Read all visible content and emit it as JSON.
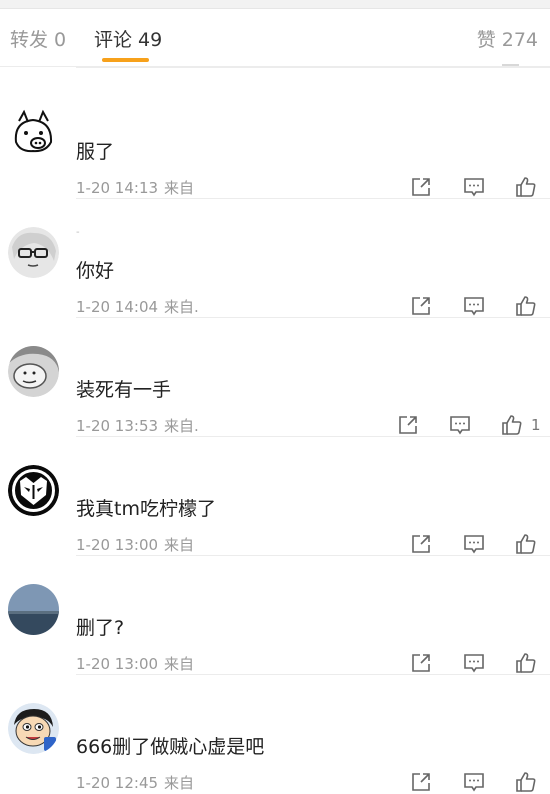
{
  "tabs": {
    "repost": "转发 0",
    "comments": "评论 49",
    "likes": "赞 274"
  },
  "accent_color": "#f7a11b",
  "comments": [
    {
      "text": "服了",
      "time": "1-20 14:13",
      "source": "来自",
      "like_count": ""
    },
    {
      "text": "你好",
      "time": "1-20 14:04",
      "source": "来自.",
      "like_count": ""
    },
    {
      "text": "装死有一手",
      "time": "1-20 13:53",
      "source": "来自.",
      "like_count": "1"
    },
    {
      "text": "我真tm吃柠檬了",
      "time": "1-20 13:00",
      "source": "来自",
      "like_count": ""
    },
    {
      "text": "删了?",
      "time": "1-20 13:00",
      "source": "来自",
      "like_count": ""
    },
    {
      "text": "666删了做贼心虚是吧",
      "time": "1-20 12:45",
      "source": "来自",
      "like_count": ""
    }
  ],
  "icons": {
    "repost": "share-box-icon",
    "comment": "comment-bubble-icon",
    "like": "thumbs-up-icon"
  }
}
